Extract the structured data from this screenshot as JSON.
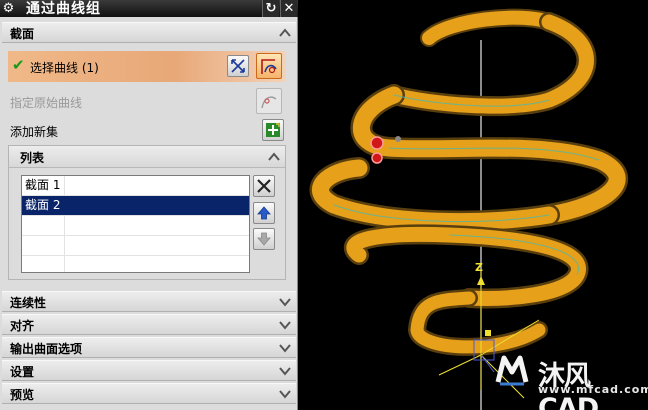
{
  "dialog": {
    "title": "通过曲线组",
    "sections": {
      "sections_label": "截面",
      "select_curve_label": "选择曲线 (1)",
      "specify_original_label": "指定原始曲线",
      "add_new_set_label": "添加新集",
      "list_label": "列表",
      "list_items": [
        {
          "name": "截面",
          "index": "1",
          "selected": false
        },
        {
          "name": "截面",
          "index": "2",
          "selected": true
        }
      ]
    },
    "collapsed_sections": [
      "连续性",
      "对齐",
      "输出曲面选项",
      "设置",
      "预览"
    ]
  },
  "viewport": {
    "axis_label": "Z",
    "watermark_brand": "沐风CAD",
    "watermark_url": "www.mfcad.com",
    "colors": {
      "ribbon_fill": "#e6a01a",
      "ribbon_edge": "#f7d264",
      "ribbon_shadow": "#7a5410",
      "axis": "#e8e8e8",
      "accent": "#e8a070"
    }
  }
}
